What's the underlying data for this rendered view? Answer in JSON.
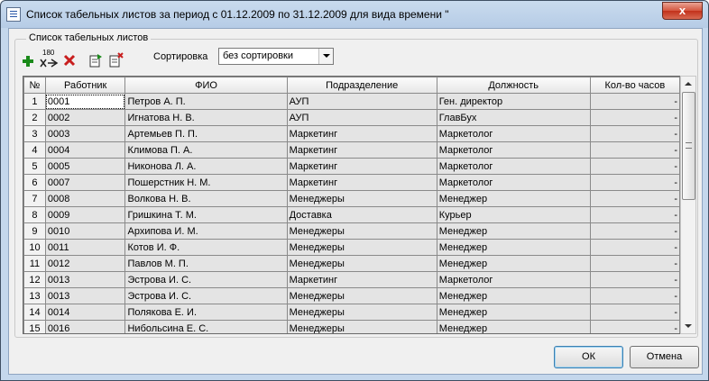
{
  "window": {
    "title": "Список табельных листов за период с 01.12.2009 по 31.12.2009 для вида времени \"",
    "close_label": "x"
  },
  "group": {
    "label": "Список табельных листов"
  },
  "toolbar": {
    "add_icon": "plus-icon",
    "generate_icon": "generate-180-icon",
    "generate_label": "180",
    "delete_icon": "red-x-icon",
    "open_icon": "document-arrow-icon",
    "remove_icon": "document-x-icon",
    "sort_label": "Сортировка",
    "sort_value": "без сортировки"
  },
  "table": {
    "headers": {
      "num": "№",
      "worker": "Работник",
      "fio": "ФИО",
      "dept": "Подразделение",
      "position": "Должность",
      "hours": "Кол-во часов"
    },
    "rows": [
      {
        "num": "1",
        "worker": "0001",
        "fio": "Петров А. П.",
        "dept": "АУП",
        "position": "Ген. директор",
        "hours": "-"
      },
      {
        "num": "2",
        "worker": "0002",
        "fio": "Игнатова Н. В.",
        "dept": "АУП",
        "position": "ГлавБух",
        "hours": "-"
      },
      {
        "num": "3",
        "worker": "0003",
        "fio": "Артемьев П. П.",
        "dept": "Маркетинг",
        "position": "Маркетолог",
        "hours": "-"
      },
      {
        "num": "4",
        "worker": "0004",
        "fio": "Климова П. А.",
        "dept": "Маркетинг",
        "position": "Маркетолог",
        "hours": "-"
      },
      {
        "num": "5",
        "worker": "0005",
        "fio": "Никонова Л. А.",
        "dept": "Маркетинг",
        "position": "Маркетолог",
        "hours": "-"
      },
      {
        "num": "6",
        "worker": "0007",
        "fio": "Пошерстник Н. М.",
        "dept": "Маркетинг",
        "position": "Маркетолог",
        "hours": "-"
      },
      {
        "num": "7",
        "worker": "0008",
        "fio": "Волкова Н. В.",
        "dept": "Менеджеры",
        "position": "Менеджер",
        "hours": "-"
      },
      {
        "num": "8",
        "worker": "0009",
        "fio": "Гришкина Т. М.",
        "dept": "Доставка",
        "position": "Курьер",
        "hours": "-"
      },
      {
        "num": "9",
        "worker": "0010",
        "fio": "Архипова И. М.",
        "dept": "Менеджеры",
        "position": "Менеджер",
        "hours": "-"
      },
      {
        "num": "10",
        "worker": "0011",
        "fio": "Котов И. Ф.",
        "dept": "Менеджеры",
        "position": "Менеджер",
        "hours": "-"
      },
      {
        "num": "11",
        "worker": "0012",
        "fio": "Павлов М. П.",
        "dept": "Менеджеры",
        "position": "Менеджер",
        "hours": "-"
      },
      {
        "num": "12",
        "worker": "0013",
        "fio": "Эстрова И. С.",
        "dept": "Маркетинг",
        "position": "Маркетолог",
        "hours": "-"
      },
      {
        "num": "13",
        "worker": "0013",
        "fio": "Эстрова И. С.",
        "dept": "Менеджеры",
        "position": "Менеджер",
        "hours": "-"
      },
      {
        "num": "14",
        "worker": "0014",
        "fio": "Полякова Е. И.",
        "dept": "Менеджеры",
        "position": "Менеджер",
        "hours": "-"
      },
      {
        "num": "15",
        "worker": "0016",
        "fio": "Нибольсина Е. С.",
        "dept": "Менеджеры",
        "position": "Менеджер",
        "hours": "-"
      }
    ]
  },
  "buttons": {
    "ok": "ОК",
    "cancel": "Отмена"
  }
}
